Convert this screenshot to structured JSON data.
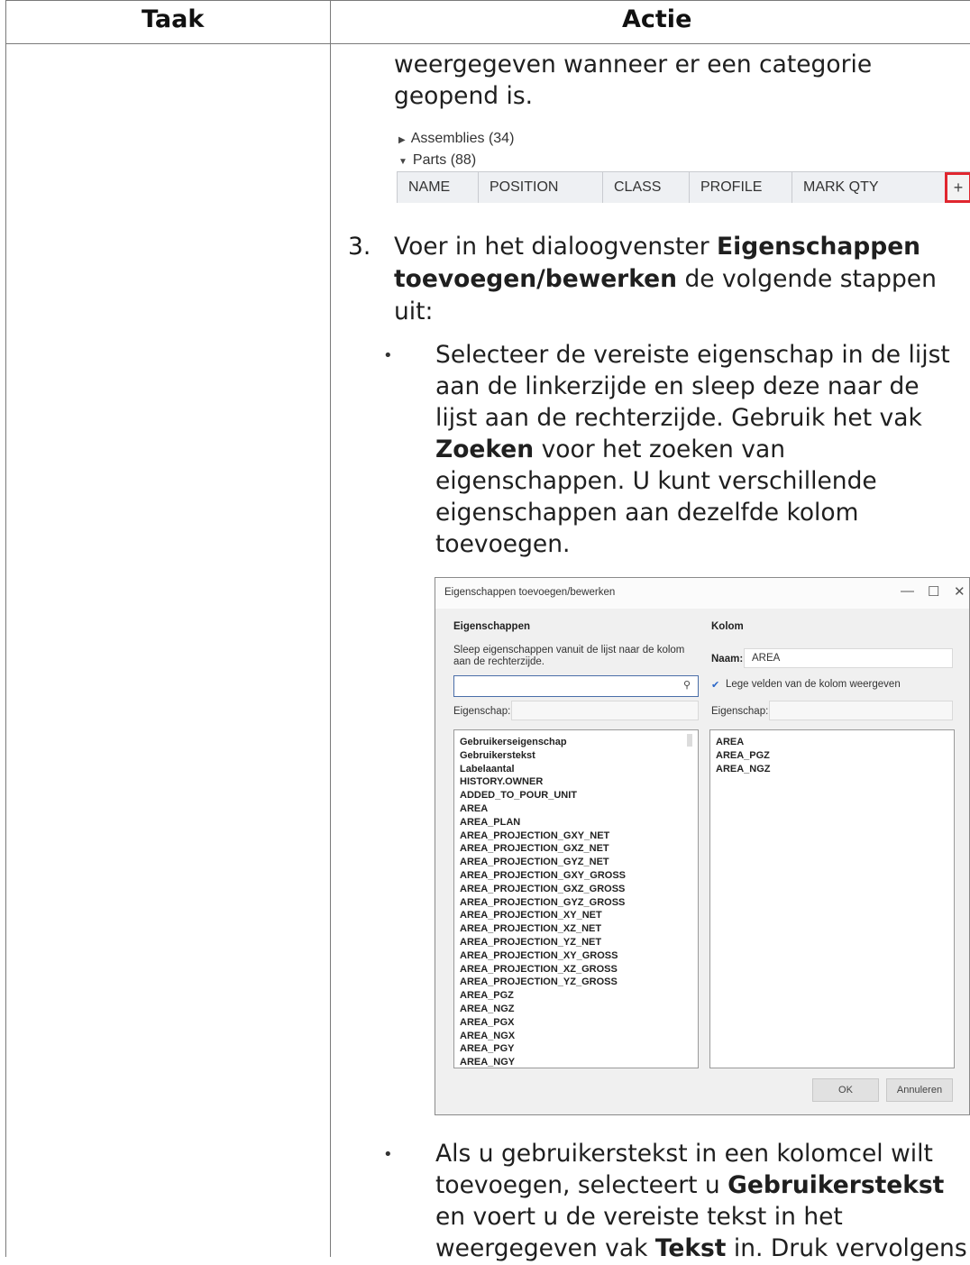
{
  "table": {
    "header_task": "Taak",
    "header_action": "Actie"
  },
  "intro": {
    "line1": "weergegeven wanneer er een categorie",
    "line2": "geopend is."
  },
  "grid_screenshot": {
    "categories": [
      "Assemblies (34)",
      "Parts (88)"
    ],
    "columns": [
      "NAME",
      "POSITION",
      "CLASS",
      "PROFILE",
      "MARK QTY"
    ],
    "add_button": "+"
  },
  "step3": {
    "number": "3.",
    "line1_pre": "Voer in het dialoogvenster ",
    "line1_bold": "Eigenschappen",
    "line2_bold": "toevoegen/bewerken",
    "line2_post": " de volgende stappen",
    "line3": "uit:"
  },
  "bullet1": {
    "line1": "Selecteer de vereiste eigenschap in de lijst",
    "line2": "aan de linkerzijde en sleep deze naar de",
    "line3": "lijst aan de rechterzijde. Gebruik het vak",
    "line4_bold": "Zoeken",
    "line4_post": " voor het zoeken van",
    "line5": "eigenschappen. U kunt verschillende",
    "line6": "eigenschappen aan dezelfde kolom",
    "line7": "toevoegen."
  },
  "dialog": {
    "title": "Eigenschappen toevoegen/bewerken",
    "window_buttons": [
      "—",
      "☐",
      "✕"
    ],
    "left_heading": "Eigenschappen",
    "instruction_line1": "Sleep eigenschappen vanuit de lijst naar de kolom",
    "instruction_line2": "aan de rechterzijde.",
    "search_value": "",
    "left_property_label": "Eigenschap:",
    "left_property_value": "",
    "right_heading": "Kolom",
    "name_label": "Naam:",
    "name_value": "AREA",
    "show_empty_checked": true,
    "show_empty_label": "Lege velden van de kolom weergeven",
    "right_property_label": "Eigenschap:",
    "right_property_value": "",
    "left_list": [
      "Gebruikerseigenschap",
      "Gebruikerstekst",
      "Labelaantal",
      "HISTORY.OWNER",
      "ADDED_TO_POUR_UNIT",
      "AREA",
      "AREA_PLAN",
      "AREA_PROJECTION_GXY_NET",
      "AREA_PROJECTION_GXZ_NET",
      "AREA_PROJECTION_GYZ_NET",
      "AREA_PROJECTION_GXY_GROSS",
      "AREA_PROJECTION_GXZ_GROSS",
      "AREA_PROJECTION_GYZ_GROSS",
      "AREA_PROJECTION_XY_NET",
      "AREA_PROJECTION_XZ_NET",
      "AREA_PROJECTION_YZ_NET",
      "AREA_PROJECTION_XY_GROSS",
      "AREA_PROJECTION_XZ_GROSS",
      "AREA_PROJECTION_YZ_GROSS",
      "AREA_PGZ",
      "AREA_NGZ",
      "AREA_PGX",
      "AREA_NGX",
      "AREA_PGY",
      "AREA_NGY"
    ],
    "right_list": [
      "AREA",
      "AREA_PGZ",
      "AREA_NGZ"
    ],
    "ok_label": "OK",
    "cancel_label": "Annuleren"
  },
  "bullet2": {
    "line1": "Als u gebruikerstekst in een kolomcel wilt",
    "line2_pre": "toevoegen, selecteert u ",
    "line2_bold": "Gebruikerstekst",
    "line3": "en voert u de vereiste tekst in het",
    "line4_pre": "weergegeven vak ",
    "line4_bold": "Tekst",
    "line4_post": " in. Druk vervolgens"
  },
  "bullet_symbol": "•"
}
